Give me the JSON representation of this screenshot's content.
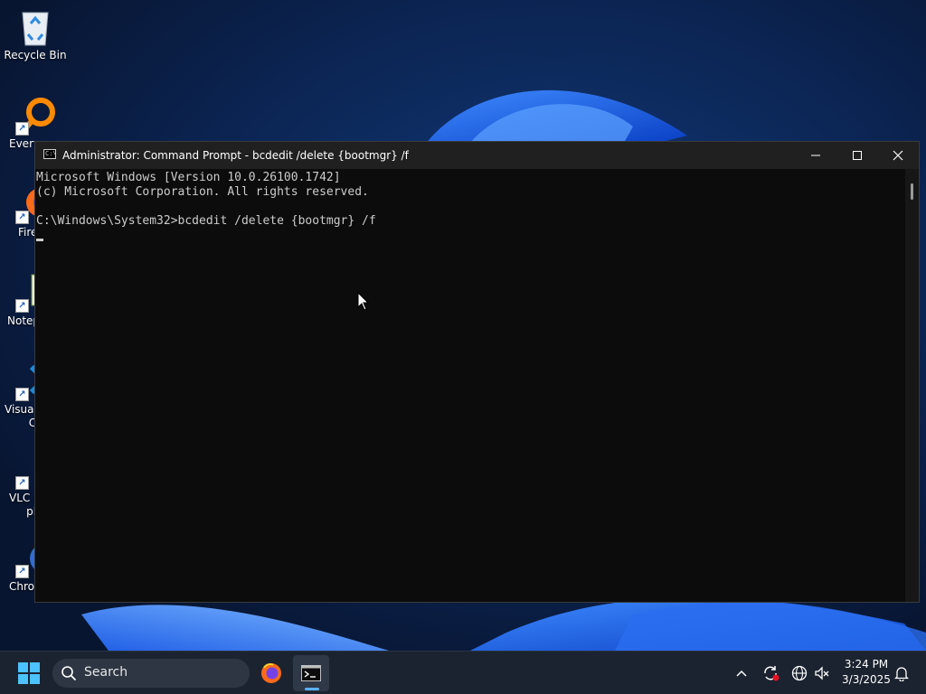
{
  "desktop": {
    "icons": [
      {
        "name": "recycle-bin",
        "label": "Recycle Bin"
      },
      {
        "name": "everything",
        "label": "Every"
      },
      {
        "name": "firefox",
        "label": "Fire"
      },
      {
        "name": "notepad",
        "label": "Notep"
      },
      {
        "name": "vscode",
        "label": "Visual\n       Co"
      },
      {
        "name": "vlc",
        "label": "VLC r\n     pla"
      },
      {
        "name": "chrome",
        "label": "Chrom"
      }
    ]
  },
  "window": {
    "title": "Administrator: Command Prompt - bcdedit  /delete {bootmgr} /f",
    "app_icon_text": "C:\\",
    "console_lines": [
      "Microsoft Windows [Version 10.0.26100.1742]",
      "(c) Microsoft Corporation. All rights reserved.",
      "",
      "C:\\Windows\\System32>bcdedit /delete {bootmgr} /f"
    ]
  },
  "taskbar": {
    "search_placeholder": "Search",
    "time": "3:24 PM",
    "date": "3/3/2025"
  },
  "colors": {
    "console_bg": "#0c0c0c",
    "console_text": "#cccccc",
    "titlebar": "#202020",
    "taskbar": "#1c2330",
    "accent": "#5ab0ff"
  }
}
